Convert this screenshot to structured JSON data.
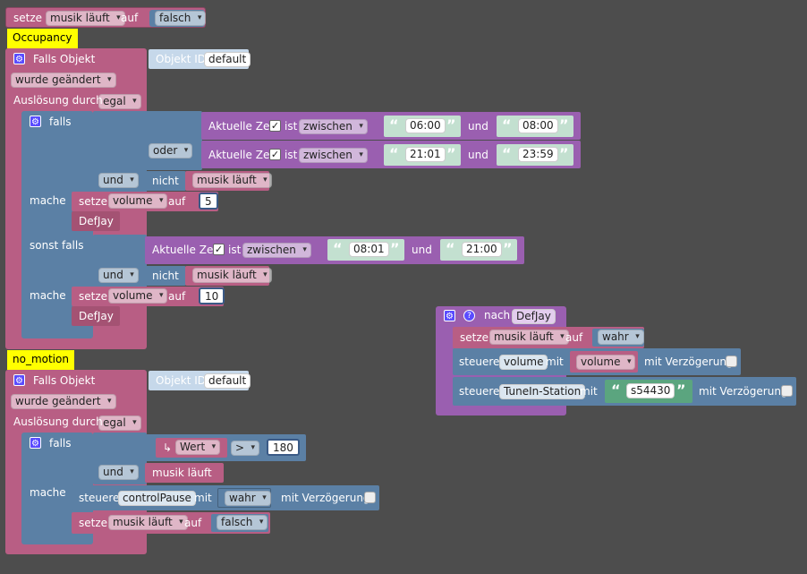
{
  "labels": {
    "setze": "setze",
    "auf": "auf",
    "falls_objekt": "Falls Objekt",
    "objekt_id": "Objekt ID",
    "auslosung_durch": "Auslösung durch",
    "falls": "falls",
    "mache": "mache",
    "sonst_falls": "sonst falls",
    "aktuelle_zeit": "Aktuelle Zeit",
    "ist": "ist",
    "und": "und",
    "nicht": "nicht",
    "steuere": "steuere",
    "mit": "mit",
    "mit_verzogerung": "mit Verzögerung",
    "nach": "nach",
    "arrow": "▾",
    "check": "✓",
    "gear": "⚙",
    "question": "?",
    "quote_open": "“",
    "quote_close": "”"
  },
  "top": {
    "variable": "musik läuft",
    "value": "falsch"
  },
  "comments": [
    "Occupancy",
    "no_motion"
  ],
  "trigger1": {
    "object_id": "default",
    "changed": "wurde geändert",
    "trigger": "egal",
    "cond1": {
      "from": "06:00",
      "to": "08:00",
      "op": "zwischen"
    },
    "or_label": "oder",
    "cond2": {
      "from": "21:01",
      "to": "23:59",
      "op": "zwischen"
    },
    "and_label": "und",
    "not_var": "musik läuft",
    "set1": {
      "variable": "volume",
      "value": "5"
    },
    "call1": "DefJay",
    "cond3": {
      "from": "08:01",
      "to": "21:00",
      "op": "zwischen"
    },
    "and2_label": "und",
    "not_var2": "musik läuft",
    "set2": {
      "variable": "volume",
      "value": "10"
    },
    "call2": "DefJay"
  },
  "trigger2": {
    "object_id": "default",
    "changed": "wurde geändert",
    "trigger": "egal",
    "wert_label": "Wert",
    "compare_op": ">",
    "compare_value": "180",
    "and_label": "und",
    "and_var": "musik läuft",
    "control": "controlPause",
    "control_value": "wahr",
    "set_variable": "musik läuft",
    "set_value": "falsch"
  },
  "function": {
    "name": "DefJay",
    "set_variable": "musik läuft",
    "set_value": "wahr",
    "control1": "volume",
    "control1_value": "volume",
    "control2": "TuneIn-Station",
    "control2_value": "s54430"
  },
  "colors": {
    "variables": "#b85e84",
    "logic": "#5b80a5",
    "time": "#9a5fb0",
    "text": "#5ba57f",
    "comment": "#ffff00",
    "background": "#4d4d4d"
  }
}
